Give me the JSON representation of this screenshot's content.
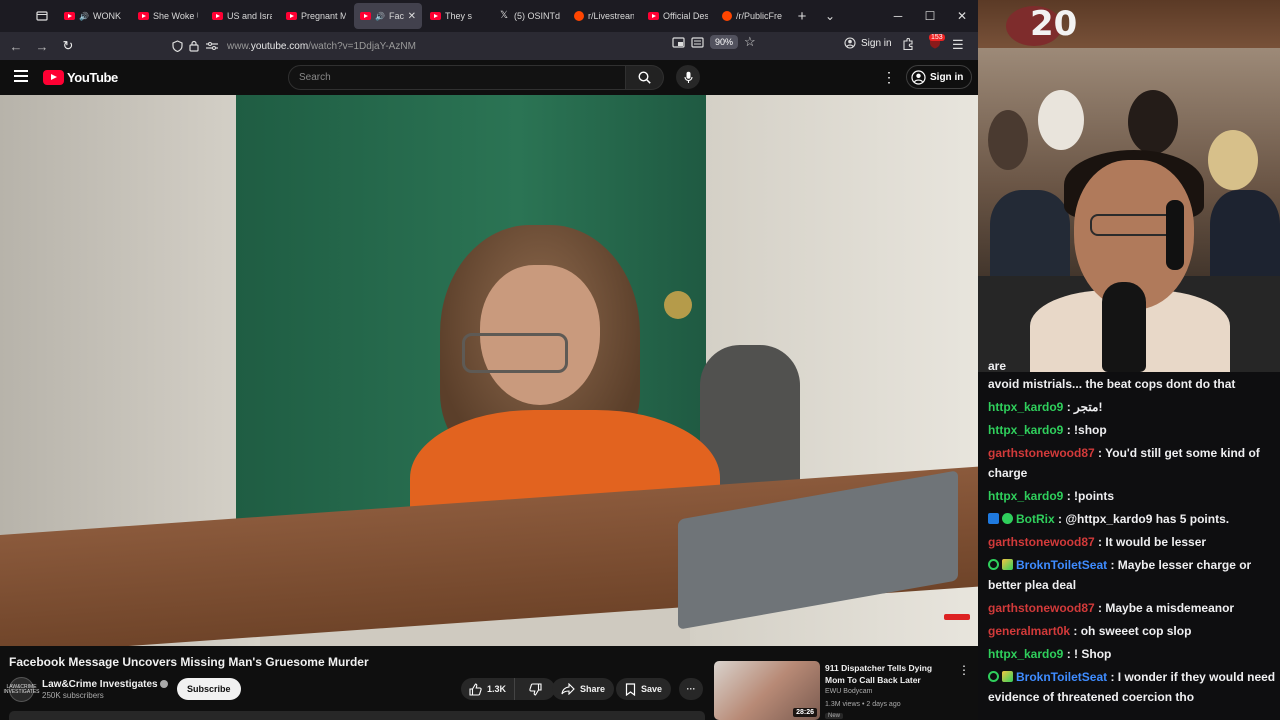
{
  "browser": {
    "tabs": [
      {
        "label": "WONK",
        "icon": "youtube-icon",
        "active": false
      },
      {
        "label": "She Woke U",
        "icon": "youtube-icon",
        "active": false
      },
      {
        "label": "US and Isra",
        "icon": "youtube-icon",
        "active": false
      },
      {
        "label": "Pregnant M",
        "icon": "youtube-icon",
        "active": false
      },
      {
        "label": "Face",
        "icon": "youtube-icon",
        "active": true
      },
      {
        "label": "They s",
        "icon": "youtube-icon",
        "active": false
      },
      {
        "label": "(5) OSINTde",
        "icon": "x-icon",
        "active": false
      },
      {
        "label": "r/Livestrean",
        "icon": "reddit-icon",
        "active": false
      },
      {
        "label": "Official Des",
        "icon": "youtube-icon",
        "active": false
      },
      {
        "label": "/r/PublicFre",
        "icon": "reddit-icon",
        "active": false
      }
    ],
    "new_tab": "+",
    "url_prefix": "www.",
    "url_domain": "youtube.com",
    "url_path": "/watch?v=1DdjaY-AzNM",
    "zoom": "90%",
    "signin_label": "Sign in",
    "extension_badge": "153"
  },
  "youtube": {
    "logo_text": "YouTube",
    "search_placeholder": "Search",
    "signin_label": "Sign in",
    "video_title": "Facebook Message Uncovers Missing Man's Gruesome Murder",
    "channel_name": "Law&Crime Investigates",
    "channel_avatar_text": "LAW&CRIME INVESTIGATES",
    "subscribers": "250K subscribers",
    "subscribe_label": "Subscribe",
    "likes": "1.3K",
    "share_label": "Share",
    "save_label": "Save",
    "recommended": {
      "title": "911 Dispatcher Tells Dying Mom To Call Back Later",
      "channel": "EWU Bodycam",
      "meta": "1.3M views • 2 days ago",
      "badge": "New",
      "duration": "28:26"
    }
  },
  "stream": {
    "overlay_logo": "20",
    "chat_cut_text": "are",
    "messages": [
      {
        "user": "",
        "color": "",
        "text": "avoid mistrials... the beat cops dont do that",
        "badges": []
      },
      {
        "user": "httpx_kardo9",
        "color": "green",
        "text": "متجر!",
        "badges": []
      },
      {
        "user": "httpx_kardo9",
        "color": "green",
        "text": "!shop",
        "badges": []
      },
      {
        "user": "garthstonewood87",
        "color": "red",
        "text": "You'd still get some kind of charge",
        "badges": []
      },
      {
        "user": "httpx_kardo9",
        "color": "green",
        "text": "!points",
        "badges": []
      },
      {
        "user": "BotRix",
        "color": "green",
        "text": "@httpx_kardo9 has 5 points.",
        "badges": [
          "bot-badge-icon",
          "verified-badge-icon"
        ]
      },
      {
        "user": "garthstonewood87",
        "color": "red",
        "text": "It would be lesser",
        "badges": []
      },
      {
        "user": "BroknToiletSeat",
        "color": "blue",
        "text": "Maybe lesser charge or better plea deal",
        "badges": [
          "subscriber-badge-icon",
          "sword-badge-icon"
        ]
      },
      {
        "user": "garthstonewood87",
        "color": "red",
        "text": "Maybe a misdemeanor",
        "badges": []
      },
      {
        "user": "generalmart0k",
        "color": "red",
        "text": "oh sweeet cop slop",
        "badges": []
      },
      {
        "user": "httpx_kardo9",
        "color": "green",
        "text": "! Shop",
        "badges": []
      },
      {
        "user": "BroknToiletSeat",
        "color": "blue",
        "text": "I wonder if they would need evidence of threatened coercion tho",
        "badges": [
          "subscriber-badge-icon",
          "sword-badge-icon"
        ]
      }
    ]
  }
}
